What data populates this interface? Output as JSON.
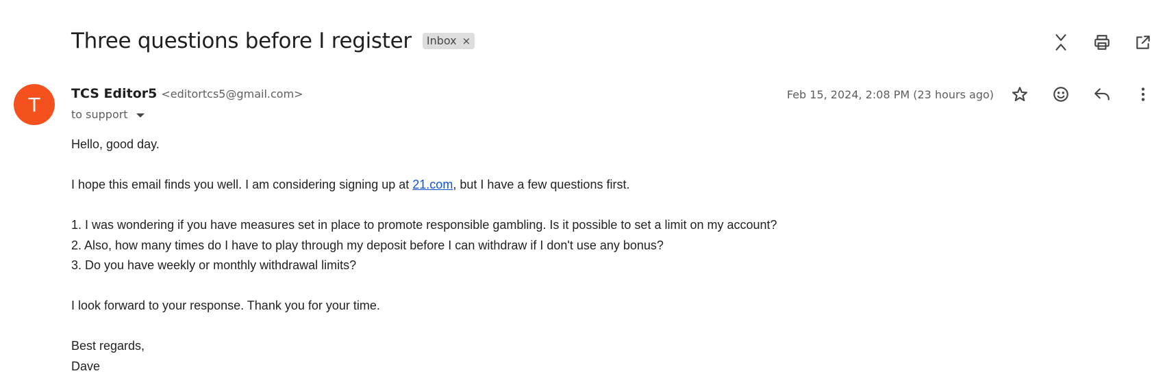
{
  "email": {
    "subject": "Three questions before I register",
    "label": "Inbox",
    "label_close": "×",
    "sender": {
      "initial": "T",
      "name": "TCS Editor5",
      "email": "<editortcs5@gmail.com>",
      "avatar_color": "#f4511e"
    },
    "to": "to support",
    "date": "Feb 15, 2024, 2:08 PM (23 hours ago)",
    "body": {
      "greeting": "Hello, good day.",
      "intro_before": "I hope this email finds you well. I am considering signing up at ",
      "intro_link": "21.com",
      "intro_after": ", but I have a few questions first.",
      "q1": "1. I was wondering if you have measures set in place to promote responsible gambling. Is it possible to set a limit on my account?",
      "q2": "2. Also, how many times do I have to play through my deposit before I can withdraw if I don't use any bonus?",
      "q3": "3. Do you have weekly or monthly withdrawal limits?",
      "closing": "I look forward to your response. Thank you for your time.",
      "signoff": "Best regards,",
      "signature": "Dave"
    }
  },
  "icons": {
    "collapse": "collapse-all-icon",
    "print": "print-icon",
    "popout": "open-in-new-window-icon",
    "star": "star-icon",
    "emoji": "emoji-reaction-icon",
    "reply": "reply-icon",
    "more": "more-vertical-icon"
  },
  "colors": {
    "link": "#1155cc",
    "chip_bg": "#dddddd",
    "avatar": "#f4511e"
  }
}
